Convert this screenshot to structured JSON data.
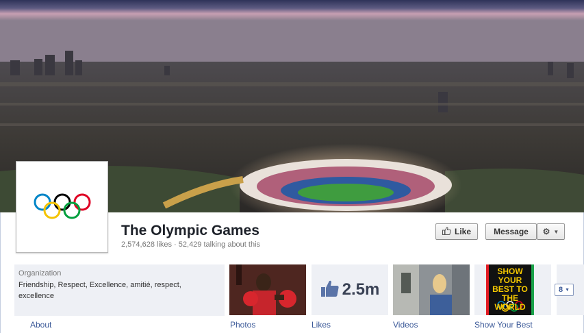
{
  "page": {
    "name": "The Olympic Games",
    "stats": "2,574,628 likes · 52,429 talking about this"
  },
  "actions": {
    "like_label": "Like",
    "message_label": "Message",
    "gear_icon": "gear-icon"
  },
  "about": {
    "category": "Organization",
    "text": "Friendship, Respect, Excellence, amitié, respect, excellence",
    "label": "About"
  },
  "tiles": {
    "photos_label": "Photos",
    "likes_label": "Likes",
    "likes_value": "2.5m",
    "videos_label": "Videos",
    "showbest_label": "Show Your Best",
    "showbest_poster_text": "SHOW YOUR BEST TO THE WORLD",
    "more_count": "8"
  },
  "colors": {
    "link": "#3b5998",
    "ring_blue": "#0085c7",
    "ring_yellow": "#f4c300",
    "ring_black": "#000000",
    "ring_green": "#009f3d",
    "ring_red": "#df0024"
  }
}
